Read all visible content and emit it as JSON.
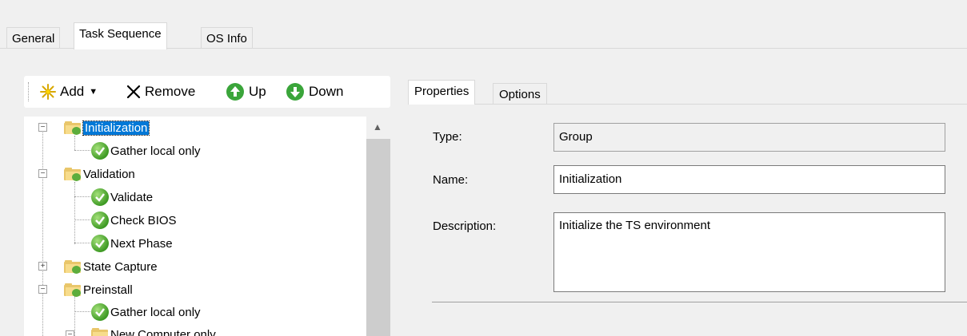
{
  "top_tabs": [
    "General",
    "Task Sequence",
    "OS Info"
  ],
  "toolbar": {
    "add_label": "Add",
    "remove_label": "Remove",
    "up_label": "Up",
    "down_label": "Down"
  },
  "tree": {
    "items": [
      {
        "label": "Initialization",
        "kind": "group",
        "expanded": true,
        "selected": true
      },
      {
        "label": "Gather local only",
        "kind": "step"
      },
      {
        "label": "Validation",
        "kind": "group",
        "expanded": true
      },
      {
        "label": "Validate",
        "kind": "step"
      },
      {
        "label": "Check BIOS",
        "kind": "step"
      },
      {
        "label": "Next Phase",
        "kind": "step"
      },
      {
        "label": "State Capture",
        "kind": "group",
        "expanded": false
      },
      {
        "label": "Preinstall",
        "kind": "group",
        "expanded": true
      },
      {
        "label": "Gather local only",
        "kind": "step"
      },
      {
        "label": "New Computer only",
        "kind": "group",
        "expanded": true
      }
    ]
  },
  "right_tabs": [
    "Properties",
    "Options"
  ],
  "properties": {
    "type_label": "Type:",
    "type_value": "Group",
    "name_label": "Name:",
    "name_value": "Initialization",
    "description_label": "Description:",
    "description_value": "Initialize the TS environment"
  },
  "colors": {
    "selection": "#0078d7",
    "folder": "#e9c66a",
    "check_green": "#3e9a24"
  },
  "icons": {
    "add": "add-sparkle-icon",
    "remove": "remove-x-icon",
    "up": "up-arrow-circle-icon",
    "down": "down-arrow-circle-icon"
  }
}
